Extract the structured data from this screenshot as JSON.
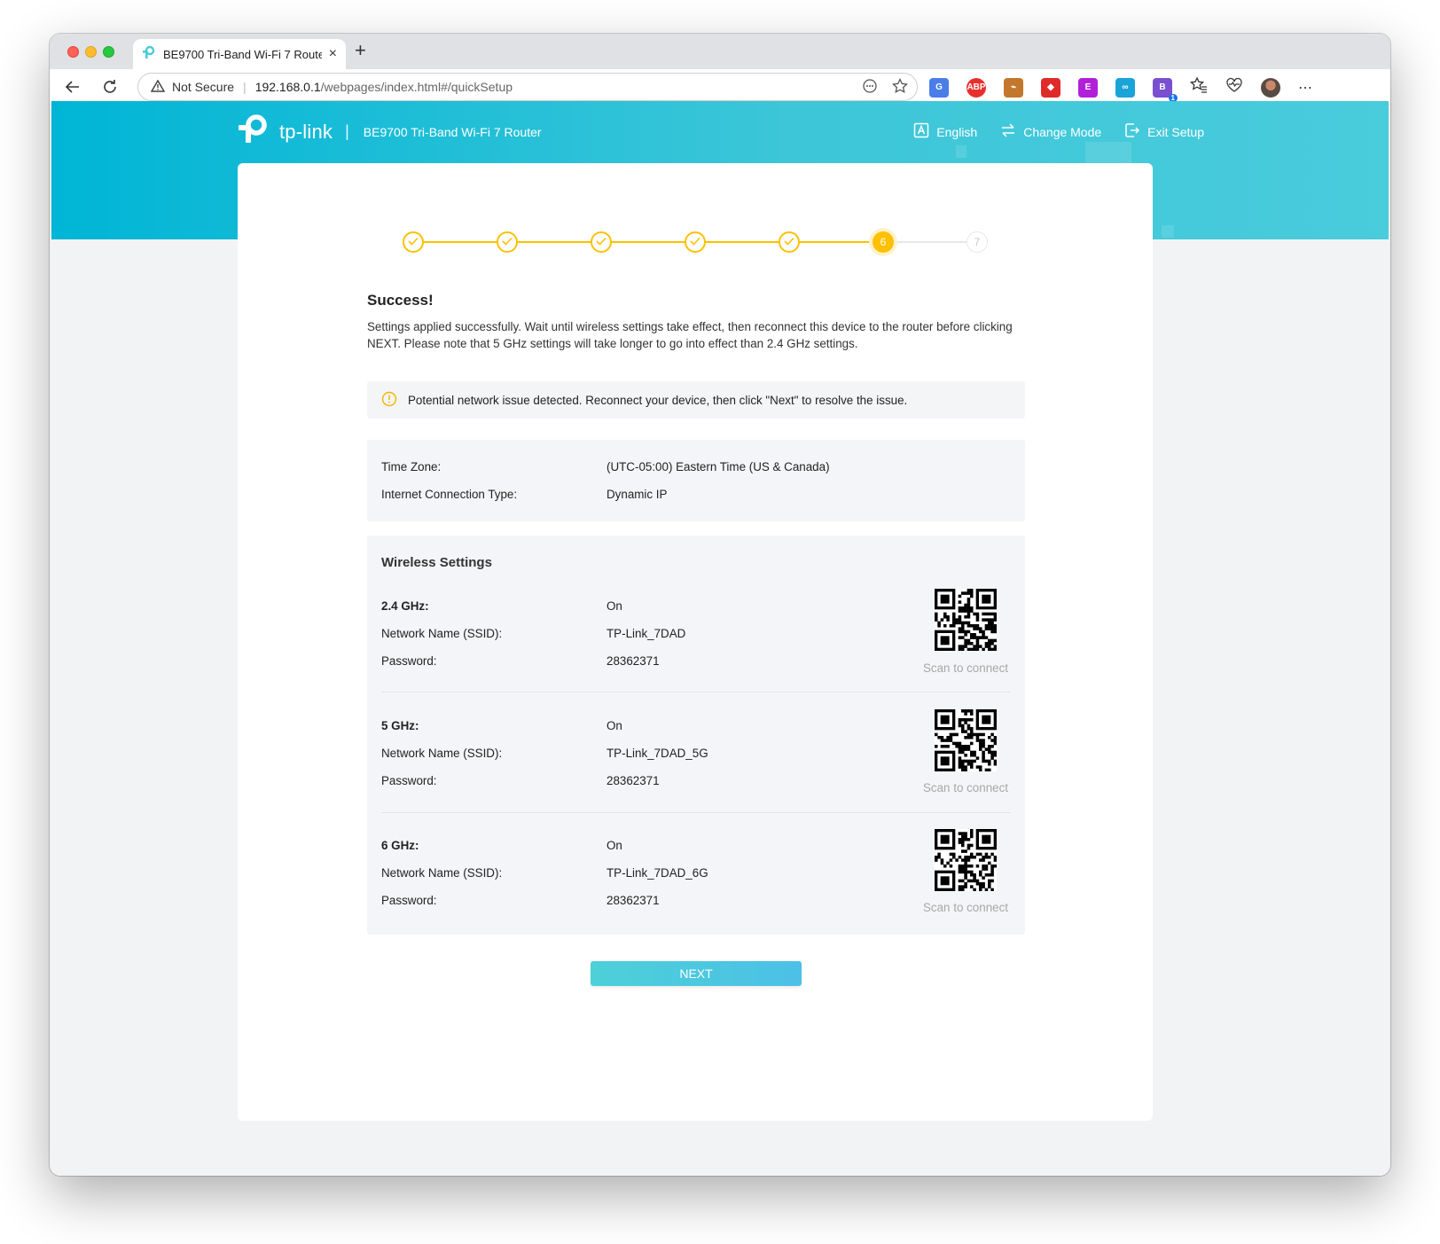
{
  "browser": {
    "tab_title": "BE9700 Tri-Band Wi-Fi 7 Route",
    "security_label": "Not Secure",
    "url_host": "192.168.0.1",
    "url_path": "/webpages/index.html#/quickSetup",
    "extension_badge": "1"
  },
  "header": {
    "brand": "tp-link",
    "model": "BE9700 Tri-Band Wi-Fi 7 Router",
    "language_label": "English",
    "change_mode_label": "Change Mode",
    "exit_label": "Exit Setup"
  },
  "stepper": {
    "steps": [
      "1",
      "2",
      "3",
      "4",
      "5",
      "6",
      "7"
    ],
    "current_step": "6",
    "last_step": "7",
    "completed_count": 5,
    "colors": {
      "active": "#ffc000",
      "inactive": "#e8e8e8"
    }
  },
  "result": {
    "title": "Success!",
    "description": "Settings applied successfully. Wait until wireless settings take effect, then reconnect this device to the router before clicking NEXT. Please note that 5 GHz settings will take longer to go into effect than 2.4 GHz settings.",
    "alert": "Potential network issue detected. Reconnect your device, then click \"Next\" to resolve the issue."
  },
  "summary": {
    "time_zone_label": "Time Zone:",
    "time_zone_value": "(UTC-05:00) Eastern Time (US & Canada)",
    "connection_label": "Internet Connection Type:",
    "connection_value": "Dynamic IP"
  },
  "wireless": {
    "title": "Wireless Settings",
    "bands": [
      {
        "band": "2.4 GHz:",
        "status": "On",
        "ssid_label": "Network Name (SSID):",
        "ssid": "TP-Link_7DAD",
        "password_label": "Password:",
        "password": "28362371",
        "scan_label": "Scan to connect"
      },
      {
        "band": "5 GHz:",
        "status": "On",
        "ssid_label": "Network Name (SSID):",
        "ssid": "TP-Link_7DAD_5G",
        "password_label": "Password:",
        "password": "28362371",
        "scan_label": "Scan to connect"
      },
      {
        "band": "6 GHz:",
        "status": "On",
        "ssid_label": "Network Name (SSID):",
        "ssid": "TP-Link_7DAD_6G",
        "password_label": "Password:",
        "password": "28362371",
        "scan_label": "Scan to connect"
      }
    ]
  },
  "footer": {
    "next_label": "NEXT"
  },
  "icons": [
    "tp-link-logo-icon",
    "language-icon",
    "change-mode-icon",
    "exit-icon",
    "warning-icon",
    "check-icon",
    "qr-code-icon"
  ],
  "colors": {
    "brand": "#00b5d6",
    "accent": "#ffc000",
    "button": "#4dc8e0"
  }
}
